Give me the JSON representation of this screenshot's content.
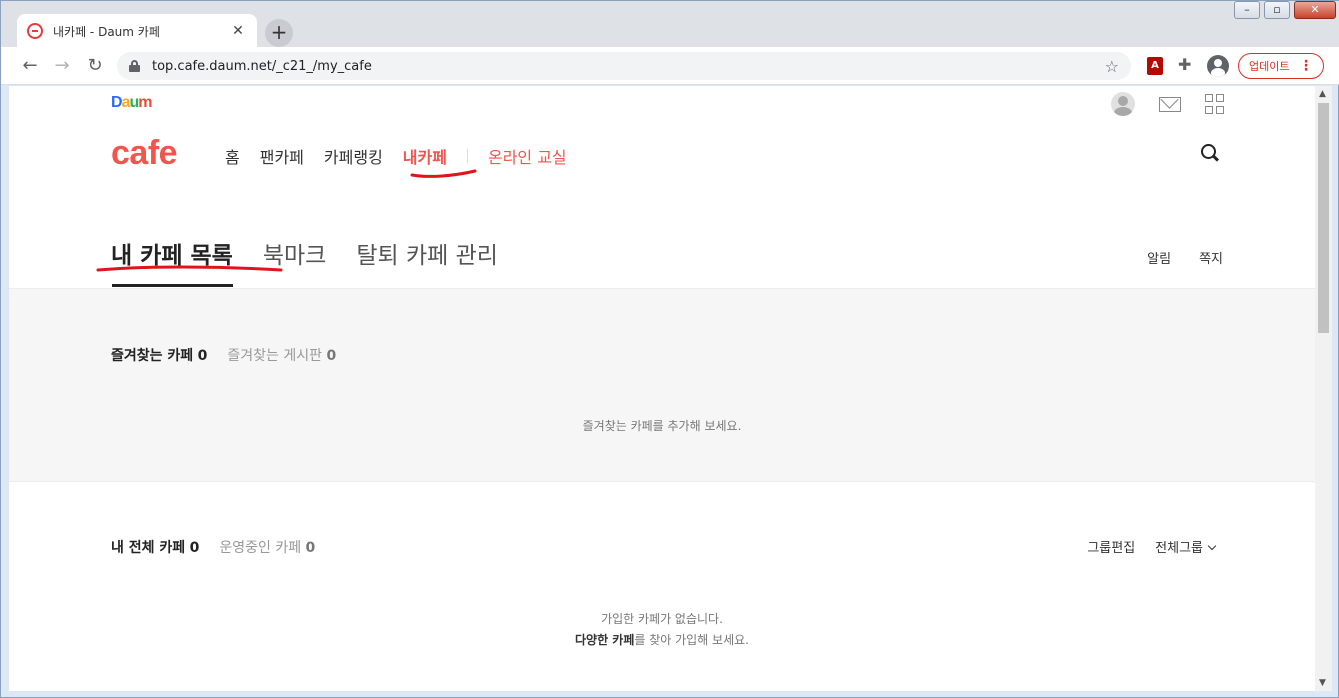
{
  "browser": {
    "tab_title": "내카페 - Daum 카페",
    "url": "top.cafe.daum.net/_c21_/my_cafe",
    "update_label": "업데이트",
    "pdf_ext_label": "A"
  },
  "daum": {
    "logo_letters": [
      "D",
      "a",
      "u",
      "m"
    ],
    "cafe_logo": "cafe"
  },
  "gnb": {
    "home": "홈",
    "fan_cafe": "팬카페",
    "ranking": "카페랭킹",
    "my_cafe": "내카페",
    "online_class": "온라인 교실"
  },
  "subtabs": {
    "my_list": "내 카페 목록",
    "bookmark": "북마크",
    "withdraw": "탈퇴 카페 관리"
  },
  "right_links": {
    "alarm": "알림",
    "message": "쪽지"
  },
  "favorites": {
    "cafe_label": "즐겨찾는 카페",
    "cafe_count": "0",
    "board_label": "즐겨찾는 게시판",
    "board_count": "0",
    "empty_text": "즐겨찾는 카페를 추가해 보세요."
  },
  "all_cafes": {
    "label": "내 전체 카페",
    "count": "0",
    "operating_label": "운영중인 카페",
    "operating_count": "0",
    "group_edit": "그룹편집",
    "group_select": "전체그룹",
    "empty_line1": "가입한 카페가 없습니다.",
    "empty_line2_bold": "다양한 카페",
    "empty_line2_rest": "를 찾아 가입해 보세요."
  },
  "colors": {
    "accent": "#f2544e",
    "annotation": "#e0151b"
  }
}
